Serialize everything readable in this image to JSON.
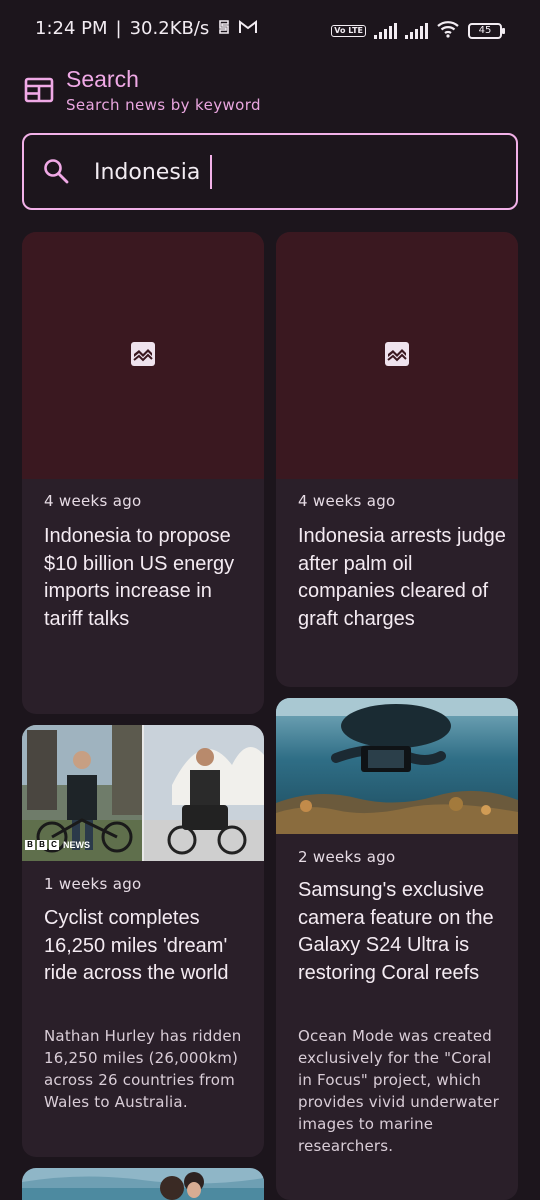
{
  "status": {
    "time": "1:24 PM",
    "speed": "30.2KB/s",
    "volte": "Vo LTE",
    "battery": "45"
  },
  "header": {
    "title": "Search",
    "subtitle": "Search news by keyword"
  },
  "search": {
    "value": "Indonesia"
  },
  "articles": [
    {
      "age": "4 weeks ago",
      "title": "Indonesia to propose $10 billion US energy imports increase in tariff talks",
      "description": ""
    },
    {
      "age": "4 weeks ago",
      "title": "Indonesia arrests judge after palm oil companies cleared of graft charges",
      "description": ""
    },
    {
      "age": "1 weeks ago",
      "title": "Cyclist completes 16,250 miles 'dream' ride across the world",
      "description": "Nathan Hurley has ridden 16,250 miles (26,000km) across 26 countries from Wales to Australia.",
      "image_badge": "NEWS",
      "badge_letters": [
        "B",
        "B",
        "C"
      ]
    },
    {
      "age": "2 weeks ago",
      "title": "Samsung's exclusive camera feature on the Galaxy S24 Ultra is restoring Coral reefs",
      "description": "Ocean Mode was created exclusively for the \"Coral in Focus\" project, which provides vivid underwater images to marine researchers."
    }
  ],
  "colors": {
    "background": "#1c151c",
    "card": "#2a1f29",
    "accent": "#f0a9e6",
    "placeholder": "#3a1820"
  }
}
